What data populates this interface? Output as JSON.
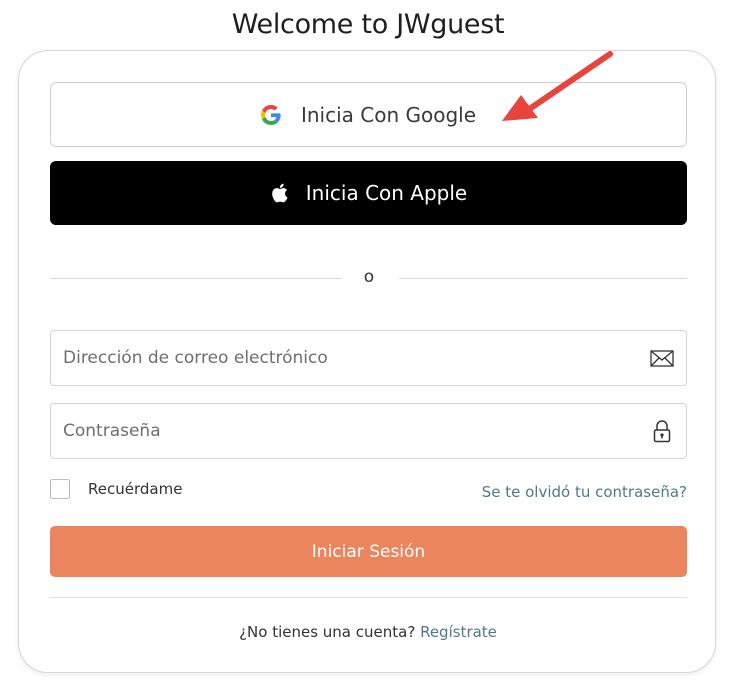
{
  "page": {
    "title": "Welcome to JWguest"
  },
  "social": {
    "google_label": "Inicia Con Google",
    "apple_label": "Inicia Con Apple"
  },
  "divider": {
    "text": "o"
  },
  "form": {
    "email_placeholder": "Dirección de correo electrónico",
    "password_placeholder": "Contraseña",
    "remember_label": "Recuérdame",
    "forgot_label": "Se te olvidó tu contraseña?",
    "submit_label": "Iniciar Sesión"
  },
  "signup": {
    "prompt": "¿No tienes una cuenta?",
    "link": "Regístrate"
  },
  "icons": {
    "google": "google-g-icon",
    "apple": "apple-icon",
    "email": "envelope-icon",
    "password": "padlock-icon",
    "annotation": "red-arrow-annotation"
  },
  "colors": {
    "accent": "#eb855e",
    "link": "#4e7a88",
    "apple_button": "#000000",
    "annotation_arrow": "#e8443e"
  }
}
